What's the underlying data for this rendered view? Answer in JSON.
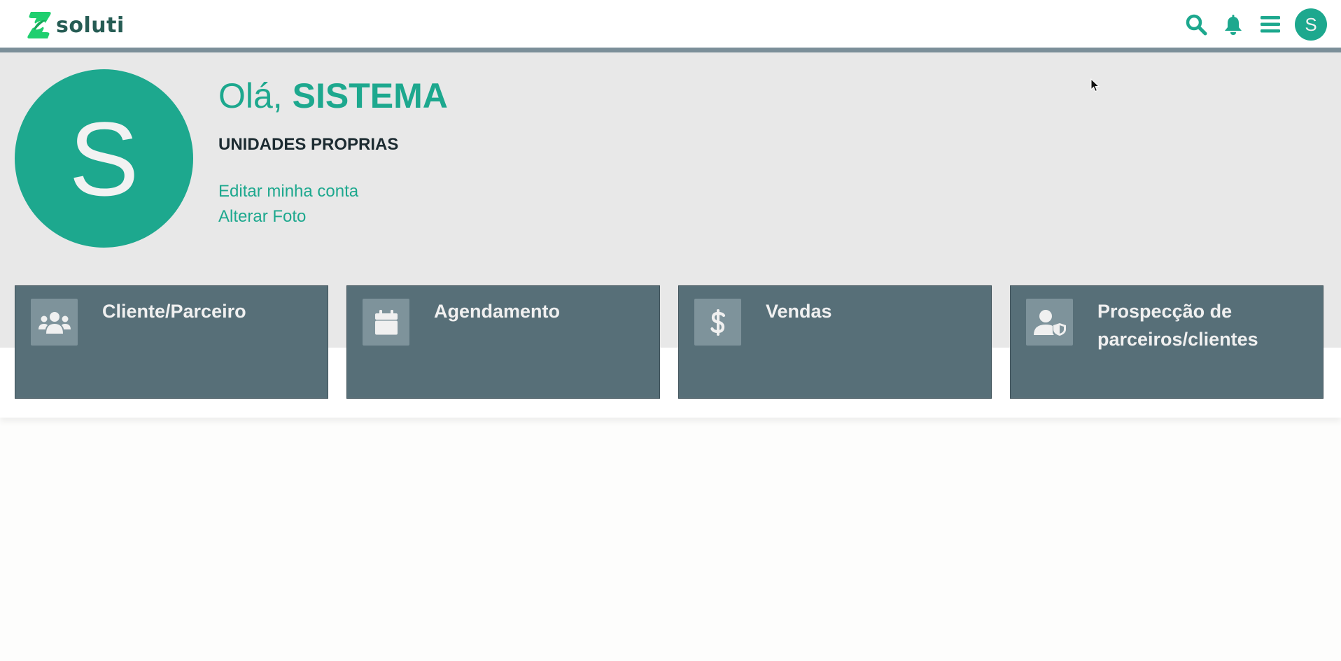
{
  "header": {
    "brand_name": "soluti",
    "brand_color": "#265c54",
    "accent_color": "#1da88e",
    "icons": [
      "search-icon",
      "bell-icon",
      "menu-icon"
    ],
    "avatar_initial": "S"
  },
  "profile": {
    "avatar_initial": "S",
    "greeting_prefix": "Olá,",
    "user_name": "SISTEMA",
    "unit_name": "UNIDADES PROPRIAS",
    "edit_account_link": "Editar minha conta",
    "change_photo_link": "Alterar Foto"
  },
  "cards": [
    {
      "title": "Cliente/Parceiro",
      "icon": "users-icon"
    },
    {
      "title": "Agendamento",
      "icon": "calendar-icon"
    },
    {
      "title": "Vendas",
      "icon": "dollar-icon"
    },
    {
      "title": "Prospecção de parceiros/clientes",
      "icon": "user-shield-icon"
    }
  ],
  "colors": {
    "card_background": "#576f78",
    "card_icon_background": "#7e939b",
    "hero_background": "#e8e8e8"
  }
}
